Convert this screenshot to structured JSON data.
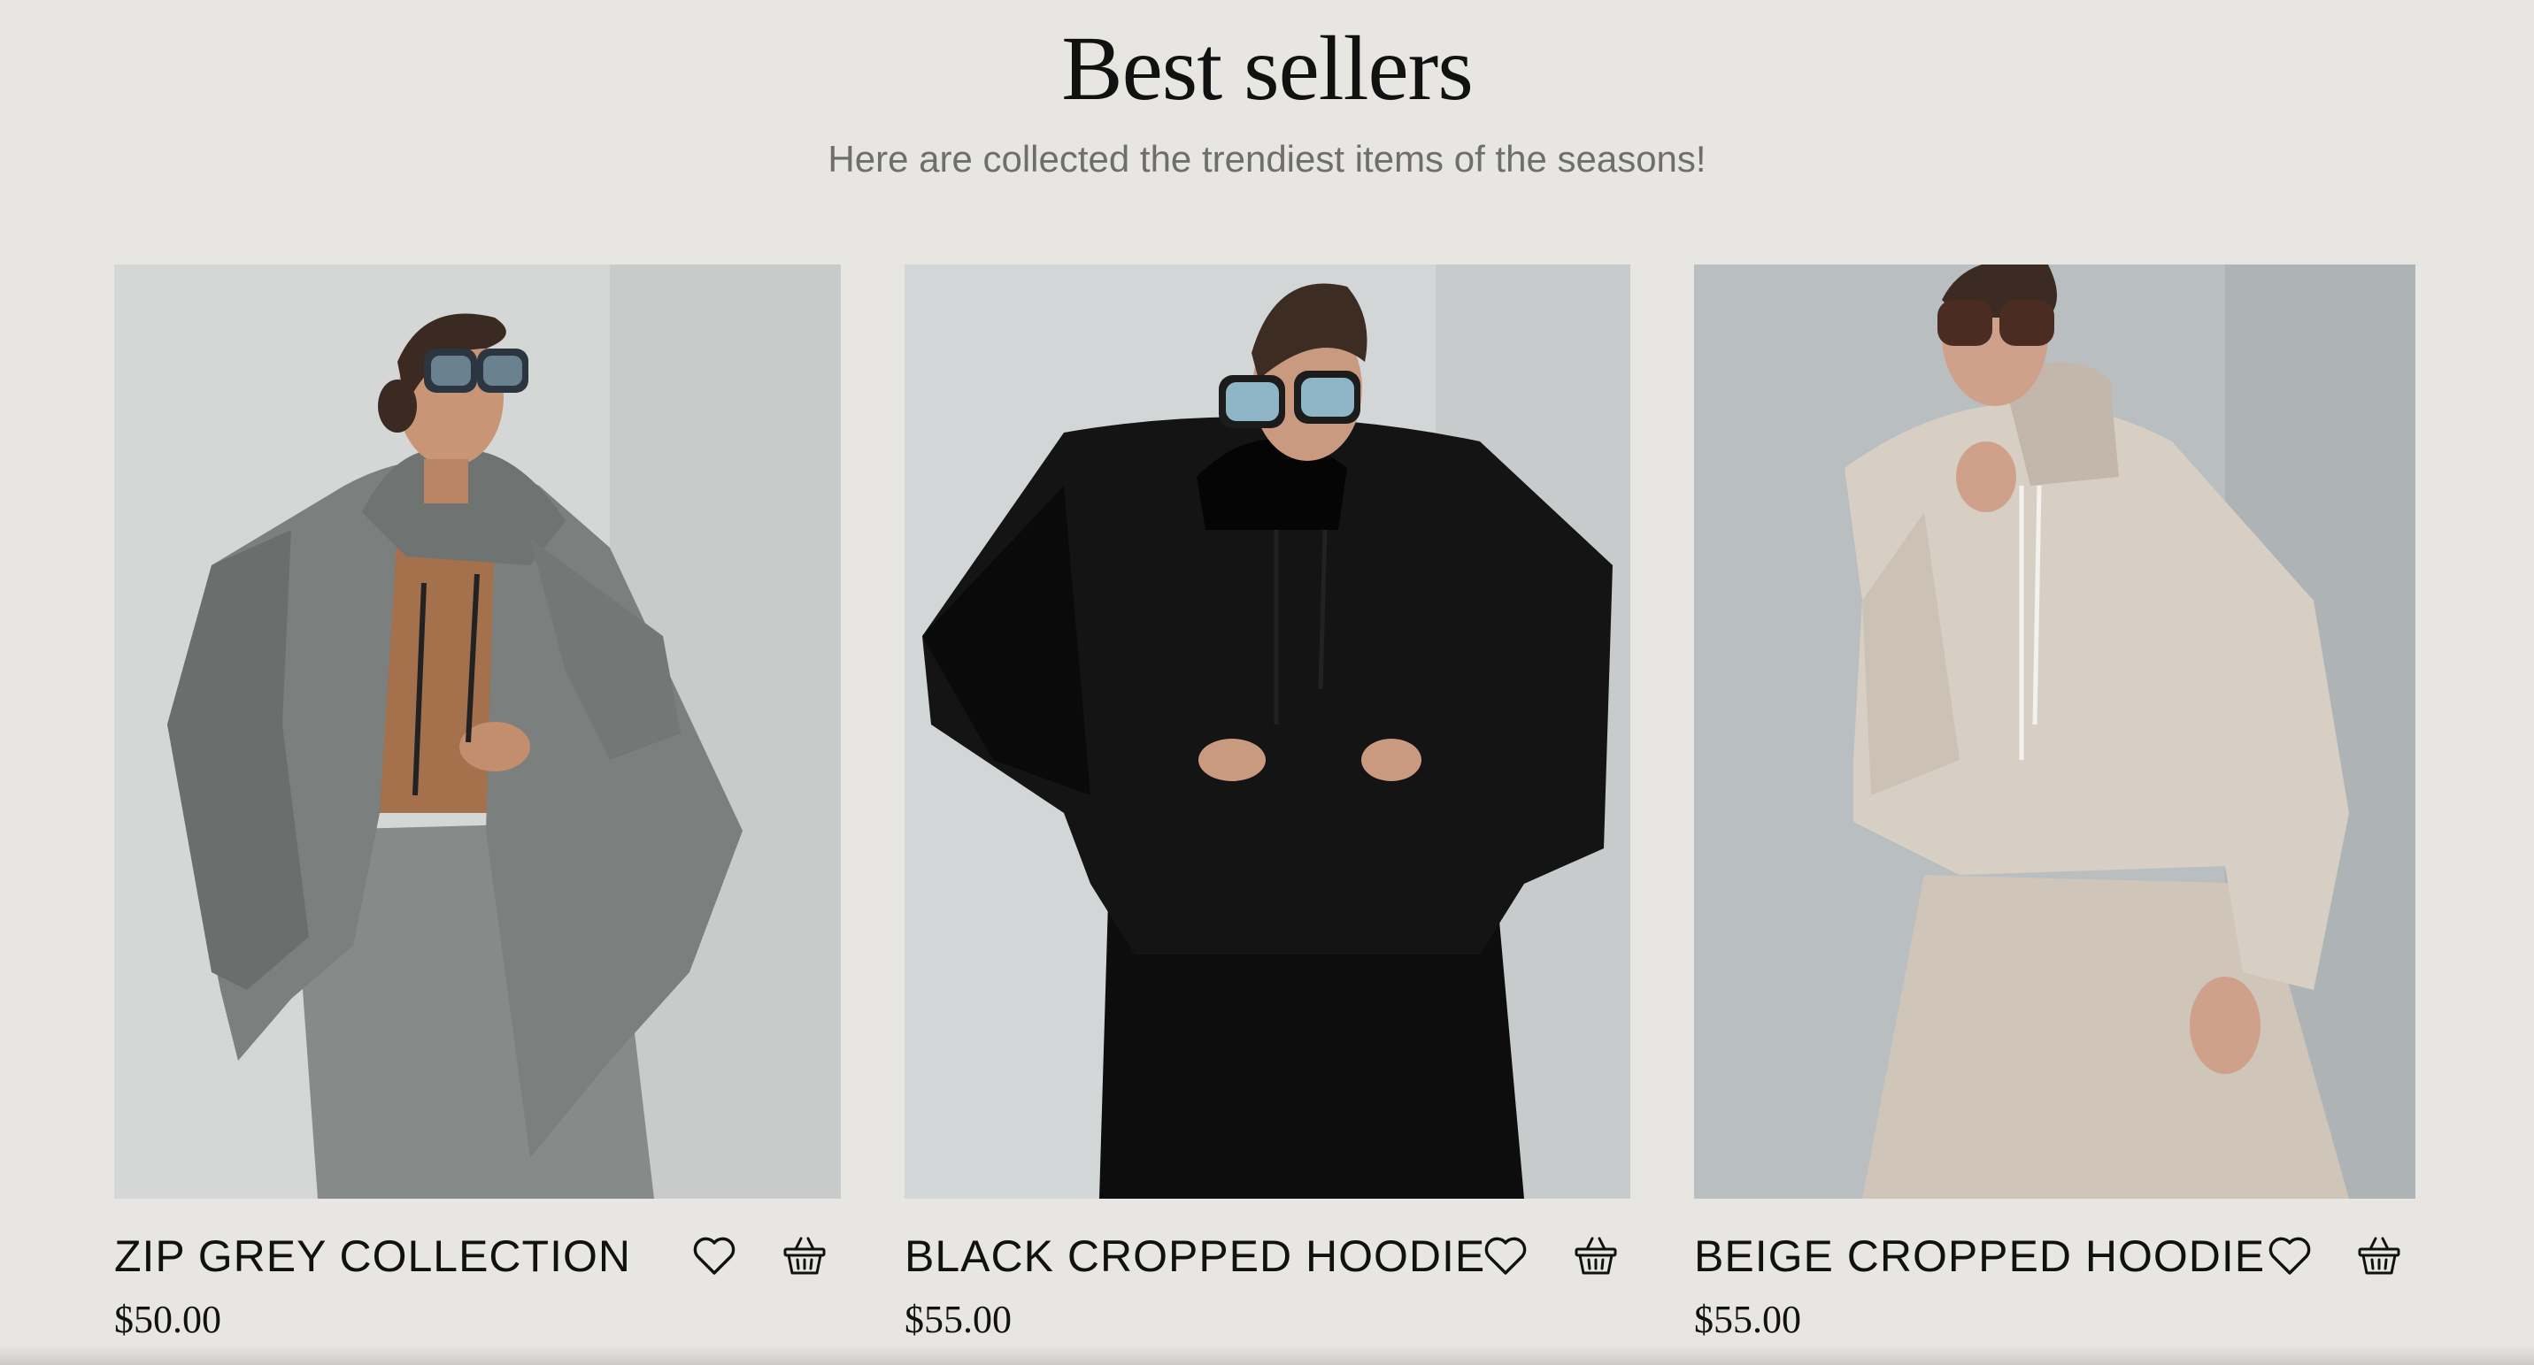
{
  "header": {
    "title": "Best sellers",
    "subtitle": "Here are collected the trendiest items of the seasons!"
  },
  "products": [
    {
      "name": "ZIP GREY COLLECTION",
      "price": "$50.00",
      "image": "model in grey zip hoodie and sweatpants",
      "favorite_icon": "heart-icon",
      "cart_icon": "basket-icon",
      "colors": {
        "background": "#d5d7d6",
        "garment": "#7b7f7e",
        "garment_shadow": "#5f6362"
      }
    },
    {
      "name": "BLACK CROPPED HOODIE",
      "price": "$55.00",
      "image": "model in black cropped hoodie and sweatpants",
      "favorite_icon": "heart-icon",
      "cart_icon": "basket-icon",
      "colors": {
        "background": "#d3d6d6",
        "garment": "#141414",
        "garment_shadow": "#000000"
      }
    },
    {
      "name": "BEIGE CROPPED HOODIE",
      "price": "$55.00",
      "image": "model in beige cropped hoodie and sweatpants",
      "favorite_icon": "heart-icon",
      "cart_icon": "basket-icon",
      "colors": {
        "background": "#b9bec1",
        "garment": "#d8cfc4",
        "garment_shadow": "#bdb3a7"
      }
    }
  ],
  "theme": {
    "page_background": "#e8e6e3",
    "text": "#111111",
    "subtitle_text": "#6e6e6e"
  }
}
